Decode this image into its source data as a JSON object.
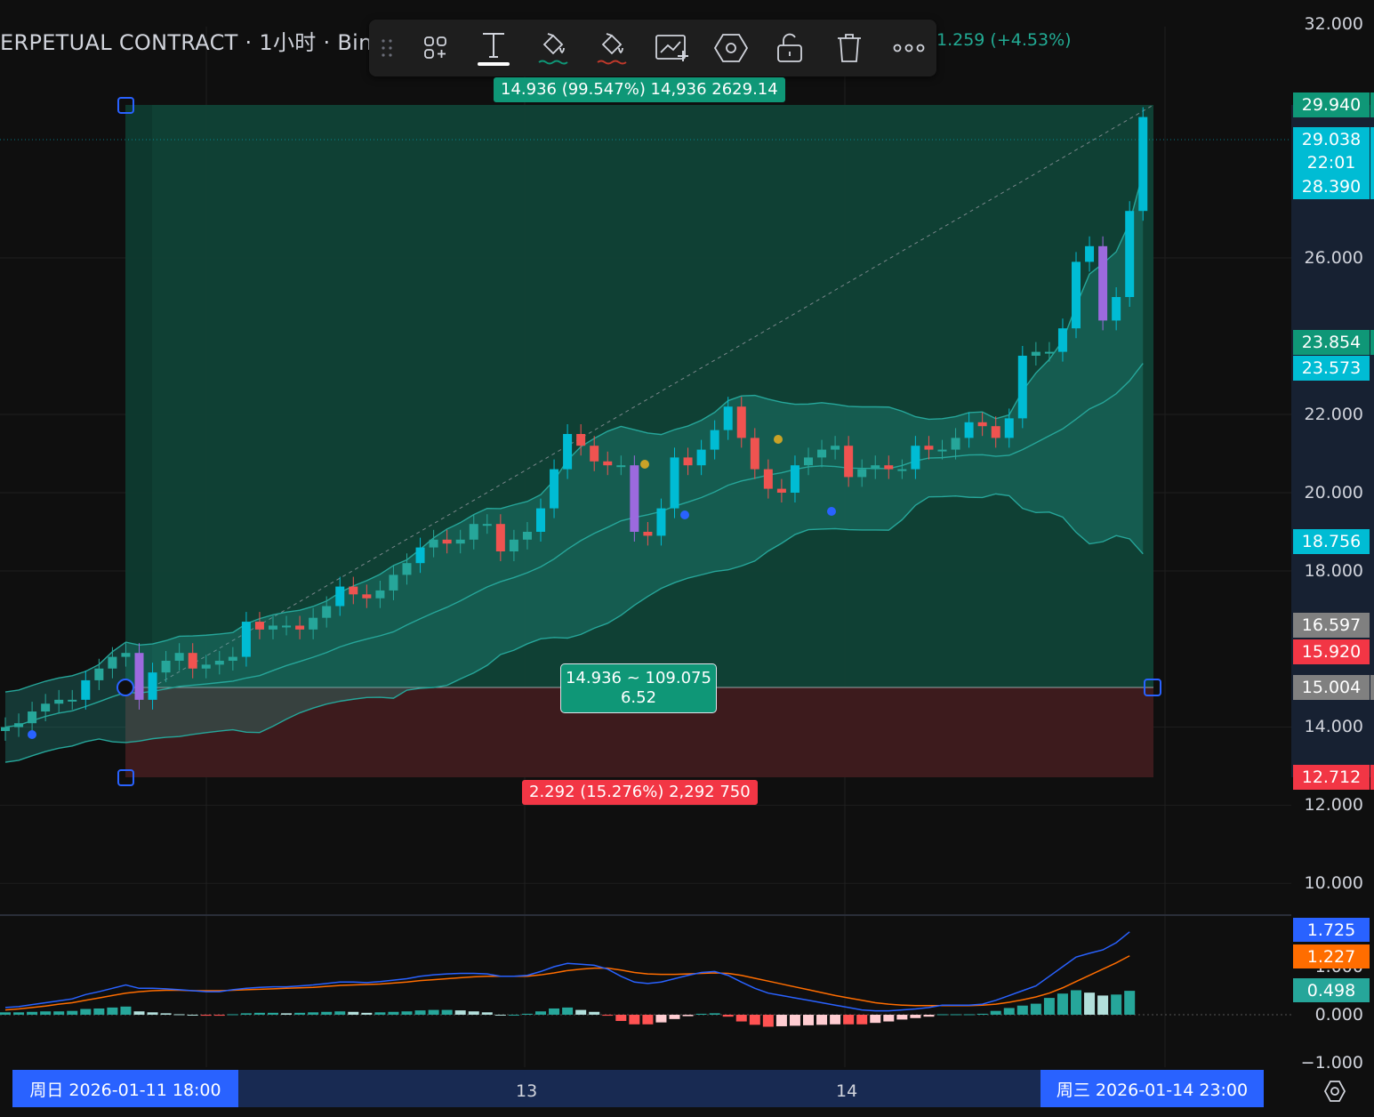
{
  "header": {
    "title": "ERPETUAL CONTRACT · 1小时 · Bin",
    "change": "1.259 (+4.53%)"
  },
  "toolbar": {
    "items": [
      {
        "icon": "drag-handle-icon"
      },
      {
        "icon": "templates-icon"
      },
      {
        "icon": "text-icon"
      },
      {
        "icon": "fill-color-icon"
      },
      {
        "icon": "stop-fill-color-icon"
      },
      {
        "icon": "add-alert-icon"
      },
      {
        "icon": "settings-hexagon-icon"
      },
      {
        "icon": "unlock-icon"
      },
      {
        "icon": "delete-icon"
      },
      {
        "icon": "more-icon"
      }
    ]
  },
  "price_scale": {
    "ticks": [
      "32.000",
      "26.000",
      "22.000",
      "20.000",
      "18.000",
      "14.000",
      "12.000",
      "10.000"
    ],
    "tags": [
      {
        "text": "29.940",
        "bg": "#0f9777"
      },
      {
        "text": "29.038",
        "bg": "#00bcd4"
      },
      {
        "text": "22:01",
        "bg": "#00bcd4"
      },
      {
        "text": "28.390",
        "bg": "#00bcd4"
      },
      {
        "text": "23.854",
        "bg": "#0f9777"
      },
      {
        "text": "23.573",
        "bg": "#00bcd4"
      },
      {
        "text": "18.756",
        "bg": "#00bcd4"
      },
      {
        "text": "16.597",
        "bg": "#808080"
      },
      {
        "text": "15.920",
        "bg": "#f23645"
      },
      {
        "text": "15.004",
        "bg": "#808080"
      },
      {
        "text": "12.712",
        "bg": "#f23645"
      }
    ]
  },
  "position_tool": {
    "target_label": "14.936 (99.547%) 14,936 2629.14",
    "stop_label": "2.292 (15.276%) 2,292 750",
    "center_line1": "14.936 ~ 109.075",
    "center_line2": "6.52"
  },
  "indicator_scale": {
    "ticks": [
      "1.000",
      "0.000",
      "−1.000"
    ],
    "tags": [
      {
        "text": "1.725",
        "bg": "#2962ff"
      },
      {
        "text": "1.227",
        "bg": "#ff6d00"
      },
      {
        "text": "0.498",
        "bg": "#26a69a"
      }
    ]
  },
  "time_axis": {
    "labels": [
      "13",
      "14"
    ],
    "start_tag": "周日 2026-01-11   18:00",
    "end_tag": "周三 2026-01-14   23:00"
  },
  "chart_data": {
    "type": "candlestick",
    "ylim": [
      9,
      32.6
    ],
    "series": [
      {
        "name": "",
        "values": [
          14.0,
          14.1,
          14.4,
          14.6,
          14.7,
          14.7,
          15.2,
          15.5,
          15.8,
          15.9,
          14.7,
          15.4,
          15.7,
          15.9,
          15.5,
          15.6,
          15.7,
          15.8,
          16.7,
          16.5,
          16.6,
          16.6,
          16.5,
          16.8,
          17.1,
          17.6,
          17.4,
          17.3,
          17.5,
          17.9,
          18.2,
          18.6,
          18.8,
          18.7,
          18.8,
          19.2,
          19.2,
          18.5,
          18.8,
          19.0,
          19.6,
          20.6,
          21.5,
          21.2,
          20.8,
          20.7,
          20.7,
          19.0,
          18.9,
          19.6,
          20.9,
          20.7,
          21.1,
          21.6,
          22.2,
          21.4,
          20.6,
          20.1,
          20.0,
          20.7,
          20.9,
          21.1,
          21.2,
          20.4,
          20.6,
          20.7,
          20.6,
          20.6,
          21.2,
          21.1,
          21.1,
          21.4,
          21.8,
          21.7,
          21.4,
          21.9,
          23.5,
          23.6,
          23.6,
          24.2,
          25.9,
          26.3,
          24.4,
          25.0,
          27.2,
          29.6
        ]
      }
    ],
    "macd": {
      "macd_line": [
        0.15,
        0.17,
        0.21,
        0.25,
        0.29,
        0.33,
        0.42,
        0.48,
        0.55,
        0.62,
        0.55,
        0.55,
        0.54,
        0.52,
        0.5,
        0.48,
        0.48,
        0.52,
        0.55,
        0.57,
        0.58,
        0.58,
        0.6,
        0.62,
        0.65,
        0.68,
        0.68,
        0.67,
        0.69,
        0.72,
        0.75,
        0.8,
        0.83,
        0.85,
        0.86,
        0.86,
        0.85,
        0.8,
        0.8,
        0.82,
        0.9,
        1.0,
        1.07,
        1.05,
        1.03,
        0.95,
        0.8,
        0.68,
        0.65,
        0.68,
        0.75,
        0.82,
        0.88,
        0.9,
        0.82,
        0.68,
        0.55,
        0.45,
        0.4,
        0.35,
        0.3,
        0.25,
        0.2,
        0.15,
        0.1,
        0.08,
        0.08,
        0.1,
        0.12,
        0.15,
        0.2,
        0.2,
        0.2,
        0.22,
        0.3,
        0.4,
        0.5,
        0.6,
        0.8,
        1.0,
        1.2,
        1.28,
        1.35,
        1.5,
        1.725
      ],
      "signal_line": [
        0.1,
        0.12,
        0.15,
        0.18,
        0.22,
        0.25,
        0.3,
        0.35,
        0.4,
        0.45,
        0.48,
        0.5,
        0.51,
        0.51,
        0.5,
        0.5,
        0.5,
        0.51,
        0.52,
        0.53,
        0.54,
        0.55,
        0.56,
        0.57,
        0.59,
        0.61,
        0.62,
        0.63,
        0.64,
        0.66,
        0.68,
        0.71,
        0.73,
        0.75,
        0.77,
        0.79,
        0.8,
        0.8,
        0.8,
        0.8,
        0.83,
        0.87,
        0.92,
        0.95,
        0.97,
        0.97,
        0.93,
        0.88,
        0.85,
        0.84,
        0.84,
        0.85,
        0.86,
        0.87,
        0.86,
        0.82,
        0.76,
        0.7,
        0.64,
        0.58,
        0.52,
        0.46,
        0.4,
        0.35,
        0.3,
        0.25,
        0.22,
        0.2,
        0.19,
        0.19,
        0.19,
        0.19,
        0.19,
        0.2,
        0.22,
        0.26,
        0.31,
        0.37,
        0.45,
        0.56,
        0.69,
        0.82,
        0.95,
        1.08,
        1.227
      ],
      "histogram": [
        0.05,
        0.05,
        0.06,
        0.07,
        0.07,
        0.08,
        0.12,
        0.13,
        0.15,
        0.17,
        0.07,
        0.05,
        0.03,
        0.01,
        0.0,
        -0.02,
        -0.02,
        0.01,
        0.03,
        0.04,
        0.04,
        0.03,
        0.04,
        0.05,
        0.06,
        0.07,
        0.06,
        0.04,
        0.05,
        0.06,
        0.07,
        0.09,
        0.1,
        0.1,
        0.09,
        0.07,
        0.05,
        0.0,
        0.0,
        0.02,
        0.07,
        0.13,
        0.15,
        0.1,
        0.06,
        -0.02,
        -0.13,
        -0.2,
        -0.2,
        -0.16,
        -0.09,
        -0.03,
        0.02,
        0.03,
        -0.04,
        -0.14,
        -0.21,
        -0.25,
        -0.24,
        -0.23,
        -0.22,
        -0.21,
        -0.2,
        -0.2,
        -0.2,
        -0.17,
        -0.14,
        -0.1,
        -0.07,
        -0.04,
        0.01,
        0.01,
        0.01,
        0.02,
        0.08,
        0.14,
        0.19,
        0.23,
        0.35,
        0.44,
        0.51,
        0.46,
        0.4,
        0.42,
        0.498
      ]
    }
  }
}
